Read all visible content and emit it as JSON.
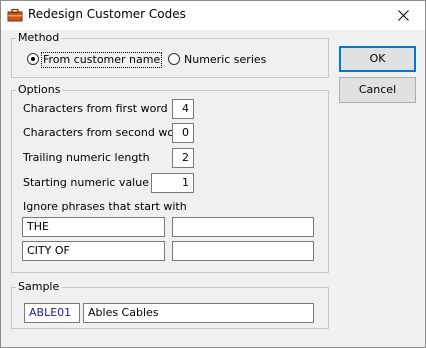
{
  "window": {
    "title": "Redesign Customer Codes"
  },
  "method": {
    "label": "Method",
    "options": [
      {
        "label": "From customer name",
        "selected": true
      },
      {
        "label": "Numeric series",
        "selected": false
      }
    ]
  },
  "buttons": {
    "ok": "OK",
    "cancel": "Cancel"
  },
  "options": {
    "label": "Options",
    "fields": [
      {
        "label": "Characters from first word",
        "value": "4"
      },
      {
        "label": "Characters from second word",
        "value": "0"
      },
      {
        "label": "Trailing numeric length",
        "value": "2"
      },
      {
        "label": "Starting numeric value",
        "value": "1"
      }
    ],
    "ignore_label": "Ignore phrases that start with",
    "ignore_phrases": [
      "THE",
      "",
      "CITY OF",
      ""
    ]
  },
  "sample": {
    "label": "Sample",
    "code": "ABLE01",
    "name": "Ables Cables",
    "code_color": "#1a1aa6"
  }
}
